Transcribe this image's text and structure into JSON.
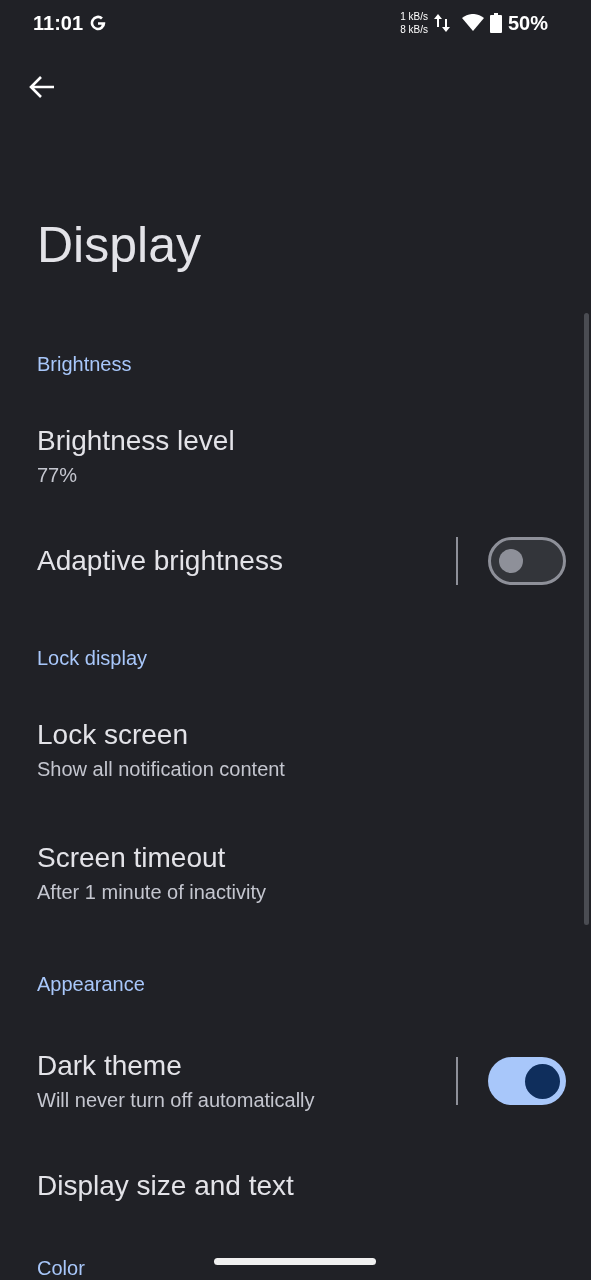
{
  "status_bar": {
    "time": "11:01",
    "net_up": "1 kB/s",
    "net_down": "8 kB/s",
    "battery": "50%"
  },
  "title": "Display",
  "sections": [
    {
      "header": "Brightness",
      "items": [
        {
          "kind": "plain",
          "title": "Brightness level",
          "summary": "77%"
        },
        {
          "kind": "switch",
          "title": "Adaptive brightness",
          "on": false
        }
      ]
    },
    {
      "header": "Lock display",
      "items": [
        {
          "kind": "plain",
          "title": "Lock screen",
          "summary": "Show all notification content"
        },
        {
          "kind": "plain",
          "title": "Screen timeout",
          "summary": "After 1 minute of inactivity"
        }
      ]
    },
    {
      "header": "Appearance",
      "items": [
        {
          "kind": "switch",
          "title": "Dark theme",
          "summary": "Will never turn off automatically",
          "on": true
        },
        {
          "kind": "plain",
          "title": "Display size and text"
        }
      ]
    },
    {
      "header": "Color"
    }
  ]
}
